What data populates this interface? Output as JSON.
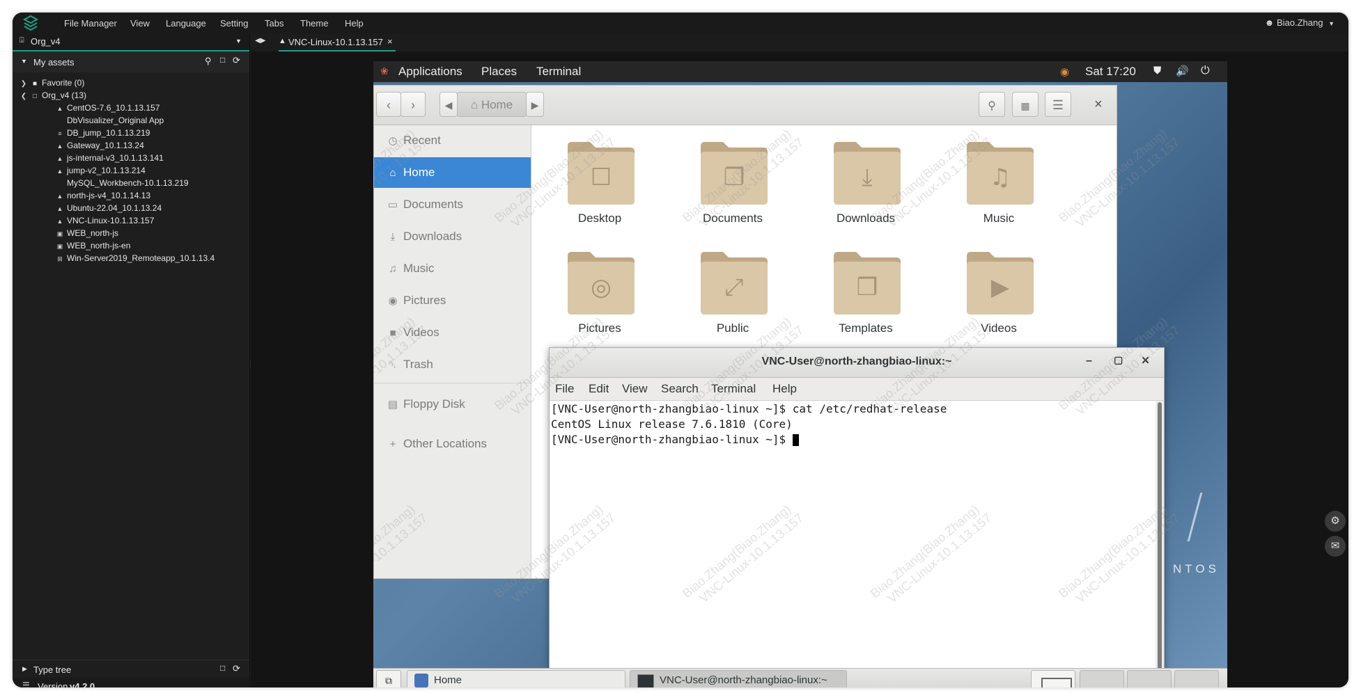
{
  "menubar": {
    "items": [
      "File Manager",
      "View",
      "Language",
      "Setting",
      "Tabs",
      "Theme",
      "Help"
    ],
    "user": "Biao.Zhang"
  },
  "sidebar": {
    "org": "Org_v4",
    "assets_title": "My assets",
    "groups": [
      {
        "label": "Favorite (0)"
      },
      {
        "label": "Org_v4 (13)"
      }
    ],
    "assets": [
      {
        "label": "CentOS-7.6_10.1.13.157",
        "icon": "linux-icon"
      },
      {
        "label": "DbVisualizer_Original App",
        "icon": ""
      },
      {
        "label": "DB_jump_10.1.13.219",
        "icon": "db-icon"
      },
      {
        "label": "Gateway_10.1.13.24",
        "icon": "linux-icon"
      },
      {
        "label": "js-internal-v3_10.1.13.141",
        "icon": "linux-icon"
      },
      {
        "label": "jump-v2_10.1.13.214",
        "icon": "linux-icon"
      },
      {
        "label": "MySQL_Workbench-10.1.13.219",
        "icon": ""
      },
      {
        "label": "north-js-v4_10.1.14.13",
        "icon": "linux-icon"
      },
      {
        "label": "Ubuntu-22.04_10.1.13.24",
        "icon": "linux-icon"
      },
      {
        "label": "VNC-Linux-10.1.13.157",
        "icon": "linux-icon"
      },
      {
        "label": "WEB_north-js",
        "icon": "web-icon"
      },
      {
        "label": "WEB_north-js-en",
        "icon": "web-icon"
      },
      {
        "label": "Win-Server2019_Remoteapp_10.1.13.4",
        "icon": "windows-icon"
      }
    ],
    "type_tree": "Type tree",
    "version_label": "Version",
    "version": "v4.2.0"
  },
  "tabs": [
    {
      "label": "VNC-Linux-10.1.13.157",
      "close": "×"
    }
  ],
  "gnome": {
    "menus": [
      "Applications",
      "Places",
      "Terminal"
    ],
    "clock": "Sat 17:20"
  },
  "nautilus": {
    "location": "Home",
    "sidebar": [
      "Recent",
      "Home",
      "Documents",
      "Downloads",
      "Music",
      "Pictures",
      "Videos",
      "Trash",
      "Floppy Disk",
      "Other Locations"
    ],
    "folders": [
      "Desktop",
      "Documents",
      "Downloads",
      "Music",
      "Pictures",
      "Public",
      "Templates",
      "Videos"
    ]
  },
  "terminal": {
    "title": "VNC-User@north-zhangbiao-linux:~",
    "menus": [
      "File",
      "Edit",
      "View",
      "Search",
      "Terminal",
      "Help"
    ],
    "lines": [
      "[VNC-User@north-zhangbiao-linux ~]$ cat /etc/redhat-release",
      "CentOS Linux release 7.6.1810 (Core)",
      "[VNC-User@north-zhangbiao-linux ~]$ "
    ]
  },
  "taskbar": {
    "items": [
      "Home",
      "VNC-User@north-zhangbiao-linux:~"
    ]
  },
  "desktop_text": "NTOS",
  "watermark": [
    "Biao.Zhang(Biao.Zhang)",
    "VNC-Linux-10.1.13.157"
  ],
  "colors": {
    "accent": "#1fa087",
    "selection": "#3b86d5",
    "folder": "#d9c7a8"
  }
}
